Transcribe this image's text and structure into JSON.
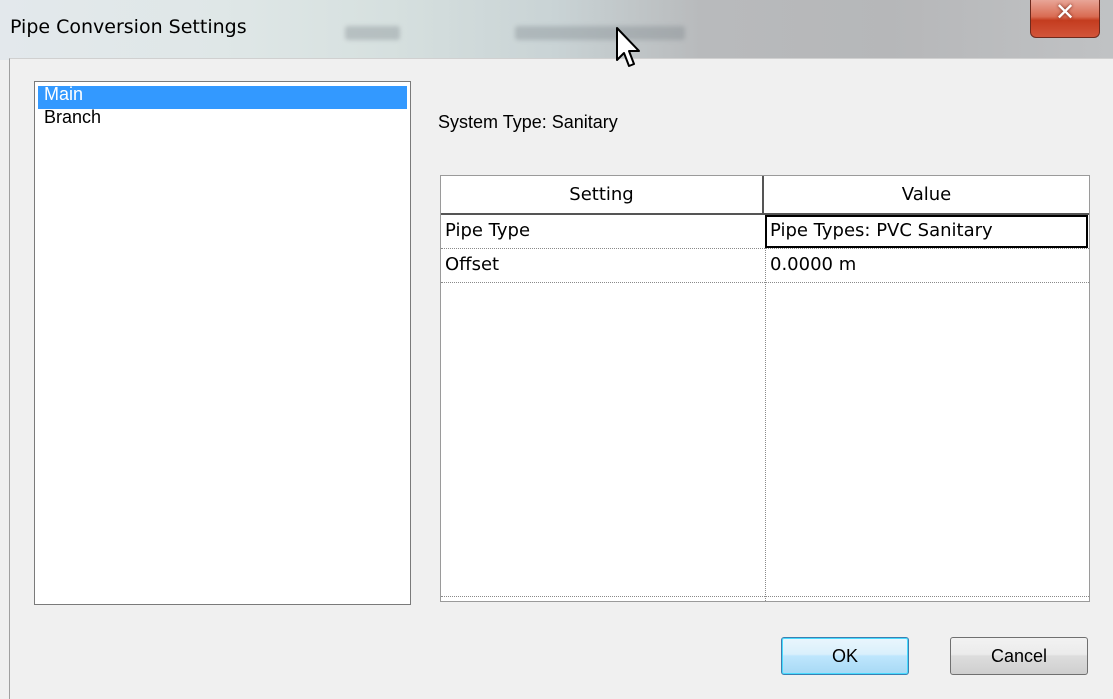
{
  "window": {
    "title": "Pipe Conversion Settings"
  },
  "category_list": {
    "items": [
      {
        "label": "Main",
        "selected": true
      },
      {
        "label": "Branch",
        "selected": false
      }
    ]
  },
  "system_type": {
    "label": "System Type: Sanitary"
  },
  "grid": {
    "headers": [
      "Setting",
      "Value"
    ],
    "rows": [
      {
        "setting": "Pipe Type",
        "value": "Pipe Types: PVC Sanitary"
      },
      {
        "setting": "Offset",
        "value": "0.0000 m"
      }
    ]
  },
  "buttons": {
    "ok_label": "OK",
    "cancel_label": "Cancel"
  },
  "colors": {
    "selection": "#3399ff",
    "close_button": "#c43c1f",
    "ok_button_border": "#3c7fb1"
  },
  "icons": {
    "close": "close-icon",
    "cursor": "mouse-cursor-icon"
  }
}
